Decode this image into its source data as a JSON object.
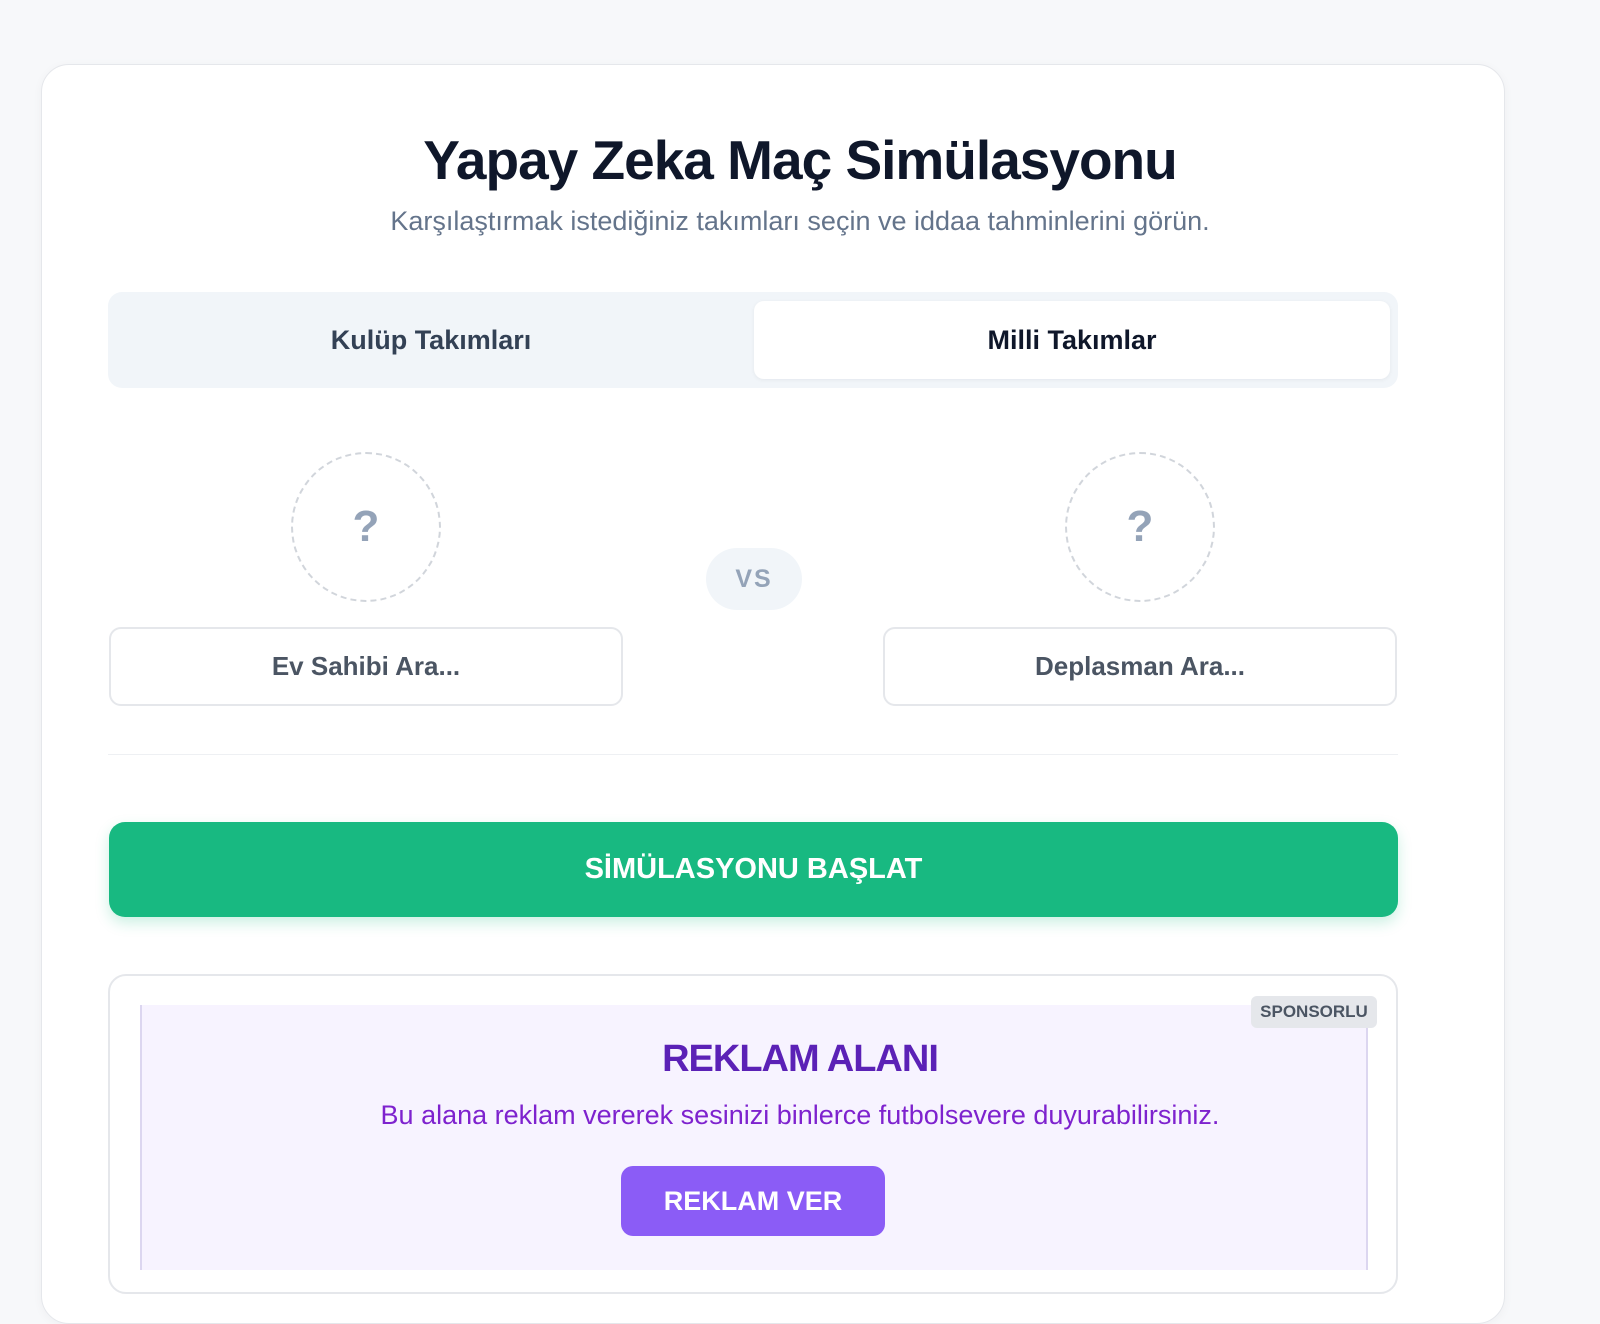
{
  "page": {
    "title": "Yapay Zeka Maç Simülasyonu",
    "subtitle": "Karşılaştırmak istediğiniz takımları seçin ve iddaa tahminlerini görün."
  },
  "tabs": [
    {
      "label": "Kulüp Takımları",
      "active": false
    },
    {
      "label": "Milli Takımlar",
      "active": true
    }
  ],
  "match": {
    "home_logo_placeholder": "?",
    "away_logo_placeholder": "?",
    "vs_label": "VS",
    "home_search_placeholder": "Ev Sahibi Ara...",
    "away_search_placeholder": "Deplasman Ara..."
  },
  "actions": {
    "start_label": "SİMÜLASYONU BAŞLAT"
  },
  "ad": {
    "badge": "SPONSORLU",
    "title": "REKLAM ALANI",
    "text": "Bu alana reklam vererek sesinizi binlerce futbolsevere duyurabilirsiniz.",
    "button_label": "REKLAM VER"
  },
  "colors": {
    "primary_green": "#18b981",
    "ad_purple": "#8b5cf6",
    "ad_title_purple": "#5b21b6",
    "title_dark": "#0f172a"
  },
  "icons": {
    "home_logo": "question-mark-icon",
    "away_logo": "question-mark-icon"
  }
}
